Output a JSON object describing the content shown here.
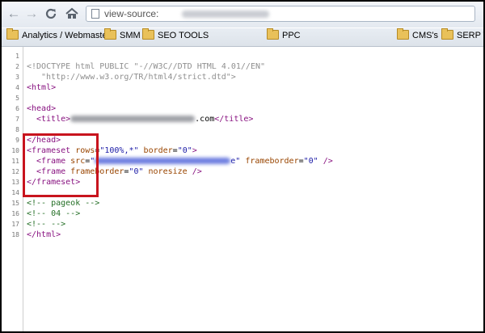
{
  "toolbar": {
    "back_icon": "back-arrow-icon",
    "forward_icon": "forward-arrow-icon",
    "reload_icon": "reload-icon",
    "home_icon": "home-icon",
    "url_prefix": "view-source:"
  },
  "bookmarks": [
    {
      "label": "Analytics / Webmaster"
    },
    {
      "label": "SMM"
    },
    {
      "label": "SEO TOOLS"
    },
    {
      "label": "PPC"
    },
    {
      "label": "CMS's"
    },
    {
      "label": "SERP Tur"
    }
  ],
  "source": {
    "line_numbers": [
      "1",
      "2",
      "3",
      "4",
      "5",
      "6",
      "7",
      "8",
      "9",
      "10",
      "11",
      "12",
      "13",
      "14",
      "15",
      "16",
      "17",
      "18"
    ],
    "l2": "<!DOCTYPE html PUBLIC \"-//W3C//DTD HTML 4.01//EN\"",
    "l3": "\"http://www.w3.org/TR/html4/strict.dtd\">",
    "l4": "<html>",
    "l6": "<head>",
    "l7_open": "<title>",
    "l7_text": ".com",
    "l7_close": "</title>",
    "l9": "</head>",
    "l10_open": "<frameset",
    "l10_a1": "rows",
    "l10_v1": "\"100%,*\"",
    "l10_a2": "border",
    "l10_v2": "\"0\"",
    "l10_close": ">",
    "l11_open": "<frame",
    "l11_a1": "src",
    "l11_v1_open": "\"",
    "l11_v1_close": "e\"",
    "l11_a2": "frameborder",
    "l11_v2": "\"0\"",
    "l11_close": "/>",
    "l12_open": "<frame",
    "l12_a1": "frameborder",
    "l12_v1": "\"0\"",
    "l12_a2": "noresize",
    "l12_close": "/>",
    "l13": "</frameset>",
    "l15": "<!-- pageok -->",
    "l16": "<!-- 04 -->",
    "l17": "<!-- -->",
    "l18": "</html>"
  },
  "colors": {
    "highlight_box": "#c8141e",
    "tag": "#881280",
    "attribute": "#994500",
    "value": "#1a1aa6",
    "comment": "#236e25"
  }
}
